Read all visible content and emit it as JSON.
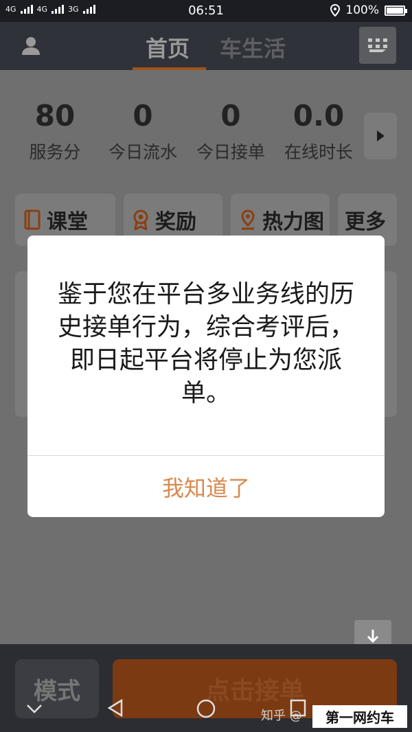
{
  "status_bar": {
    "network_1": "4G",
    "network_2": "4G",
    "network_3": "3G",
    "time": "06:51",
    "battery": "100%",
    "battery_level": 1.0
  },
  "nav": {
    "tab_home": "首页",
    "tab_car_life": "车生活"
  },
  "stats": [
    {
      "value": "80",
      "label": "服务分"
    },
    {
      "value": "0",
      "label": "今日流水"
    },
    {
      "value": "0",
      "label": "今日接单"
    },
    {
      "value": "0.0",
      "label": "在线时长"
    }
  ],
  "quick_links": [
    {
      "label": "课堂",
      "icon": "book-icon"
    },
    {
      "label": "奖励",
      "icon": "medal-icon"
    },
    {
      "label": "热力图",
      "icon": "location-pin-icon"
    },
    {
      "label": "更多",
      "icon": ""
    }
  ],
  "dialog": {
    "message": "鉴于您在平台多业务线的历史接单行为，综合考评后，即日起平台将停止为您派单。",
    "confirm_label": "我知道了"
  },
  "bottom_bar": {
    "mode_label": "模式",
    "accept_label": "点击接单"
  },
  "watermark": {
    "zhihu": "知乎 @",
    "text": "第一网约车"
  },
  "colors": {
    "accent": "#d8894d",
    "nav_bg": "#2f3238",
    "accept_bg": "#7c3a12"
  }
}
